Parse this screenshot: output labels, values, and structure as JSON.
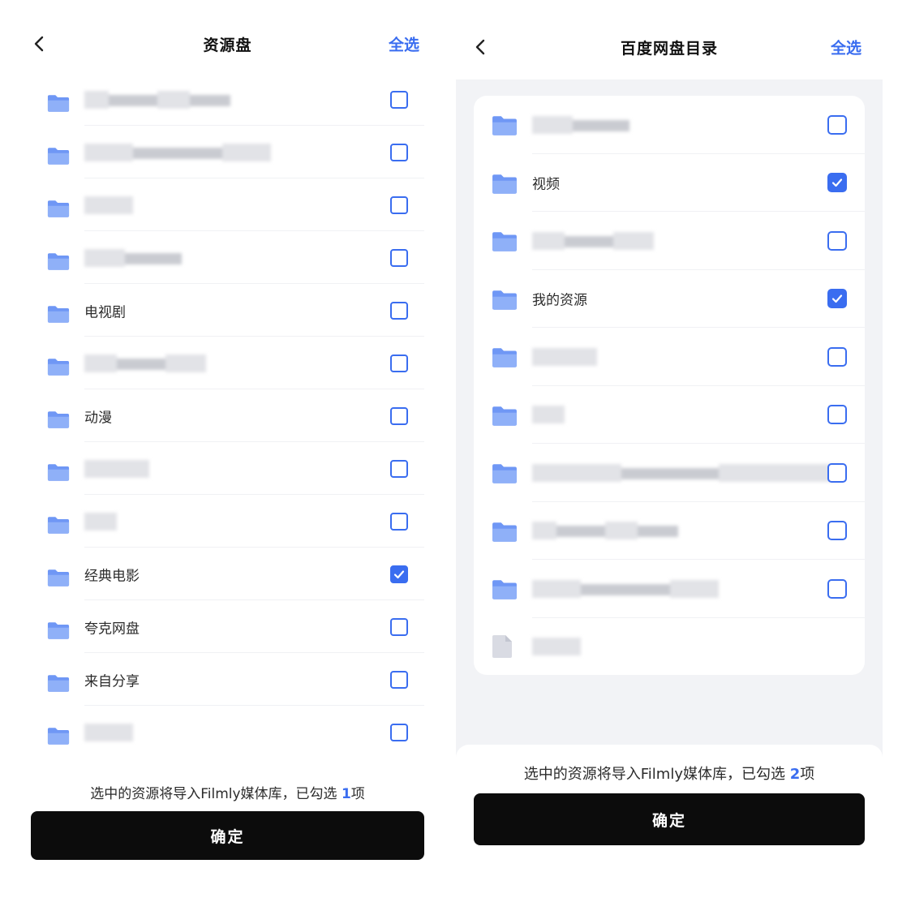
{
  "left": {
    "title": "资源盘",
    "select_all": "全选",
    "items": [
      {
        "label": "",
        "blurred": true,
        "checked": false
      },
      {
        "label": "",
        "blurred": true,
        "checked": false
      },
      {
        "label": "",
        "blurred": true,
        "checked": false
      },
      {
        "label": "",
        "blurred": true,
        "checked": false
      },
      {
        "label": "电视剧",
        "blurred": false,
        "checked": false
      },
      {
        "label": "",
        "blurred": true,
        "checked": false
      },
      {
        "label": "动漫",
        "blurred": false,
        "checked": false
      },
      {
        "label": "",
        "blurred": true,
        "checked": false
      },
      {
        "label": "",
        "blurred": true,
        "checked": false
      },
      {
        "label": "经典电影",
        "blurred": false,
        "checked": true
      },
      {
        "label": "夸克网盘",
        "blurred": false,
        "checked": false
      },
      {
        "label": "来自分享",
        "blurred": false,
        "checked": false
      },
      {
        "label": "",
        "blurred": true,
        "checked": false
      }
    ],
    "hint_prefix": "选中的资源将导入Filmly媒体库，已勾选",
    "hint_count": "1",
    "hint_suffix": "项",
    "confirm": "确定"
  },
  "right": {
    "title": "百度网盘目录",
    "select_all": "全选",
    "items": [
      {
        "label": "",
        "blurred": true,
        "checked": false,
        "type": "folder"
      },
      {
        "label": "视频",
        "blurred": false,
        "checked": true,
        "type": "folder"
      },
      {
        "label": "",
        "blurred": true,
        "checked": false,
        "type": "folder"
      },
      {
        "label": "我的资源",
        "blurred": false,
        "checked": true,
        "type": "folder"
      },
      {
        "label": "",
        "blurred": true,
        "checked": false,
        "type": "folder"
      },
      {
        "label": "",
        "blurred": true,
        "checked": false,
        "type": "folder"
      },
      {
        "label": "",
        "blurred": true,
        "checked": false,
        "type": "folder"
      },
      {
        "label": "",
        "blurred": true,
        "checked": false,
        "type": "folder"
      },
      {
        "label": "",
        "blurred": true,
        "checked": false,
        "type": "folder"
      },
      {
        "label": "",
        "blurred": true,
        "checked": false,
        "type": "file"
      }
    ],
    "hint_prefix": "选中的资源将导入Filmly媒体库，已勾选",
    "hint_count": "2",
    "hint_suffix": "项",
    "confirm": "确定"
  },
  "colors": {
    "accent": "#3a6df0",
    "folder": "#6f97f5",
    "confirm_bg": "#0c0c0c",
    "page_bg": "#f2f3f6"
  },
  "icons": {
    "back": "chevron-left-icon",
    "folder": "folder-icon",
    "file": "file-icon",
    "checkbox": "checkbox-icon",
    "check": "check-icon"
  }
}
